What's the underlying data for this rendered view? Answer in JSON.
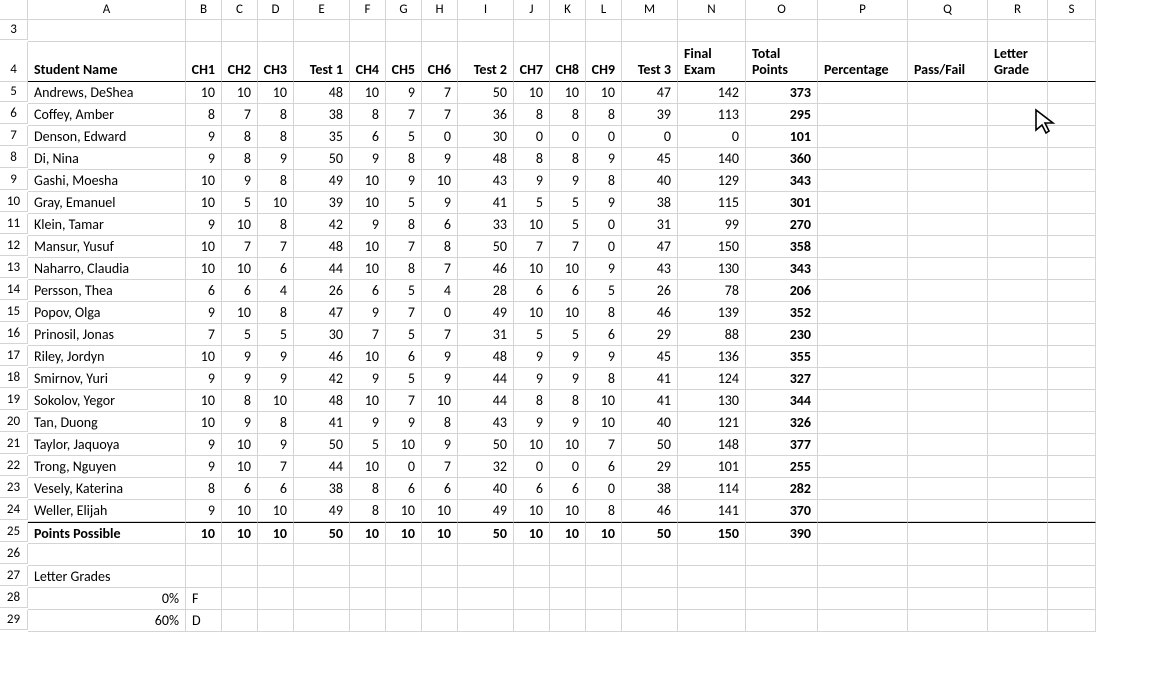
{
  "columns": [
    "A",
    "B",
    "C",
    "D",
    "E",
    "F",
    "G",
    "H",
    "I",
    "J",
    "K",
    "L",
    "M",
    "N",
    "O",
    "P",
    "Q",
    "R",
    "S"
  ],
  "first_row_num": 3,
  "headers": {
    "A": "Student Name",
    "B": "CH1",
    "C": "CH2",
    "D": "CH3",
    "E": "Test 1",
    "F": "CH4",
    "G": "CH5",
    "H": "CH6",
    "I": "Test 2",
    "J": "CH7",
    "K": "CH8",
    "L": "CH9",
    "M": "Test 3",
    "N": "Final Exam",
    "O": "Total Points",
    "P": "Percentage",
    "Q": "Pass/Fail",
    "R": "Letter Grade"
  },
  "students": [
    {
      "name": "Andrews, DeShea",
      "v": [
        10,
        10,
        10,
        48,
        10,
        9,
        7,
        50,
        10,
        10,
        10,
        47,
        142,
        373
      ]
    },
    {
      "name": "Coffey, Amber",
      "v": [
        8,
        7,
        8,
        38,
        8,
        7,
        7,
        36,
        8,
        8,
        8,
        39,
        113,
        295
      ]
    },
    {
      "name": "Denson, Edward",
      "v": [
        9,
        8,
        8,
        35,
        6,
        5,
        0,
        30,
        0,
        0,
        0,
        0,
        0,
        101
      ]
    },
    {
      "name": "Di, Nina",
      "v": [
        9,
        8,
        9,
        50,
        9,
        8,
        9,
        48,
        8,
        8,
        9,
        45,
        140,
        360
      ]
    },
    {
      "name": "Gashi, Moesha",
      "v": [
        10,
        9,
        8,
        49,
        10,
        9,
        10,
        43,
        9,
        9,
        8,
        40,
        129,
        343
      ]
    },
    {
      "name": "Gray, Emanuel",
      "v": [
        10,
        5,
        10,
        39,
        10,
        5,
        9,
        41,
        5,
        5,
        9,
        38,
        115,
        301
      ]
    },
    {
      "name": "Klein, Tamar",
      "v": [
        9,
        10,
        8,
        42,
        9,
        8,
        6,
        33,
        10,
        5,
        0,
        31,
        99,
        270
      ]
    },
    {
      "name": "Mansur, Yusuf",
      "v": [
        10,
        7,
        7,
        48,
        10,
        7,
        8,
        50,
        7,
        7,
        0,
        47,
        150,
        358
      ]
    },
    {
      "name": "Naharro, Claudia",
      "v": [
        10,
        10,
        6,
        44,
        10,
        8,
        7,
        46,
        10,
        10,
        9,
        43,
        130,
        343
      ]
    },
    {
      "name": "Persson, Thea",
      "v": [
        6,
        6,
        4,
        26,
        6,
        5,
        4,
        28,
        6,
        6,
        5,
        26,
        78,
        206
      ]
    },
    {
      "name": "Popov, Olga",
      "v": [
        9,
        10,
        8,
        47,
        9,
        7,
        0,
        49,
        10,
        10,
        8,
        46,
        139,
        352
      ]
    },
    {
      "name": "Prinosil, Jonas",
      "v": [
        7,
        5,
        5,
        30,
        7,
        5,
        7,
        31,
        5,
        5,
        6,
        29,
        88,
        230
      ]
    },
    {
      "name": "Riley, Jordyn",
      "v": [
        10,
        9,
        9,
        46,
        10,
        6,
        9,
        48,
        9,
        9,
        9,
        45,
        136,
        355
      ]
    },
    {
      "name": "Smirnov, Yuri",
      "v": [
        9,
        9,
        9,
        42,
        9,
        5,
        9,
        44,
        9,
        9,
        8,
        41,
        124,
        327
      ]
    },
    {
      "name": "Sokolov, Yegor",
      "v": [
        10,
        8,
        10,
        48,
        10,
        7,
        10,
        44,
        8,
        8,
        10,
        41,
        130,
        344
      ]
    },
    {
      "name": "Tan, Duong",
      "v": [
        10,
        9,
        8,
        41,
        9,
        9,
        8,
        43,
        9,
        9,
        10,
        40,
        121,
        326
      ]
    },
    {
      "name": "Taylor, Jaquoya",
      "v": [
        9,
        10,
        9,
        50,
        5,
        10,
        9,
        50,
        10,
        10,
        7,
        50,
        148,
        377
      ]
    },
    {
      "name": "Trong, Nguyen",
      "v": [
        9,
        10,
        7,
        44,
        10,
        0,
        7,
        32,
        0,
        0,
        6,
        29,
        101,
        255
      ]
    },
    {
      "name": "Vesely, Katerina",
      "v": [
        8,
        6,
        6,
        38,
        8,
        6,
        6,
        40,
        6,
        6,
        0,
        38,
        114,
        282
      ]
    },
    {
      "name": "Weller, Elijah",
      "v": [
        9,
        10,
        10,
        49,
        8,
        10,
        10,
        49,
        10,
        10,
        8,
        46,
        141,
        370
      ]
    }
  ],
  "points_possible": {
    "label": "Points Possible",
    "v": [
      10,
      10,
      10,
      50,
      10,
      10,
      10,
      50,
      10,
      10,
      10,
      50,
      150,
      390
    ]
  },
  "letter_section": {
    "title": "Letter Grades",
    "rows": [
      {
        "pct": "0%",
        "grade": "F"
      },
      {
        "pct": "60%",
        "grade": "D"
      }
    ]
  }
}
